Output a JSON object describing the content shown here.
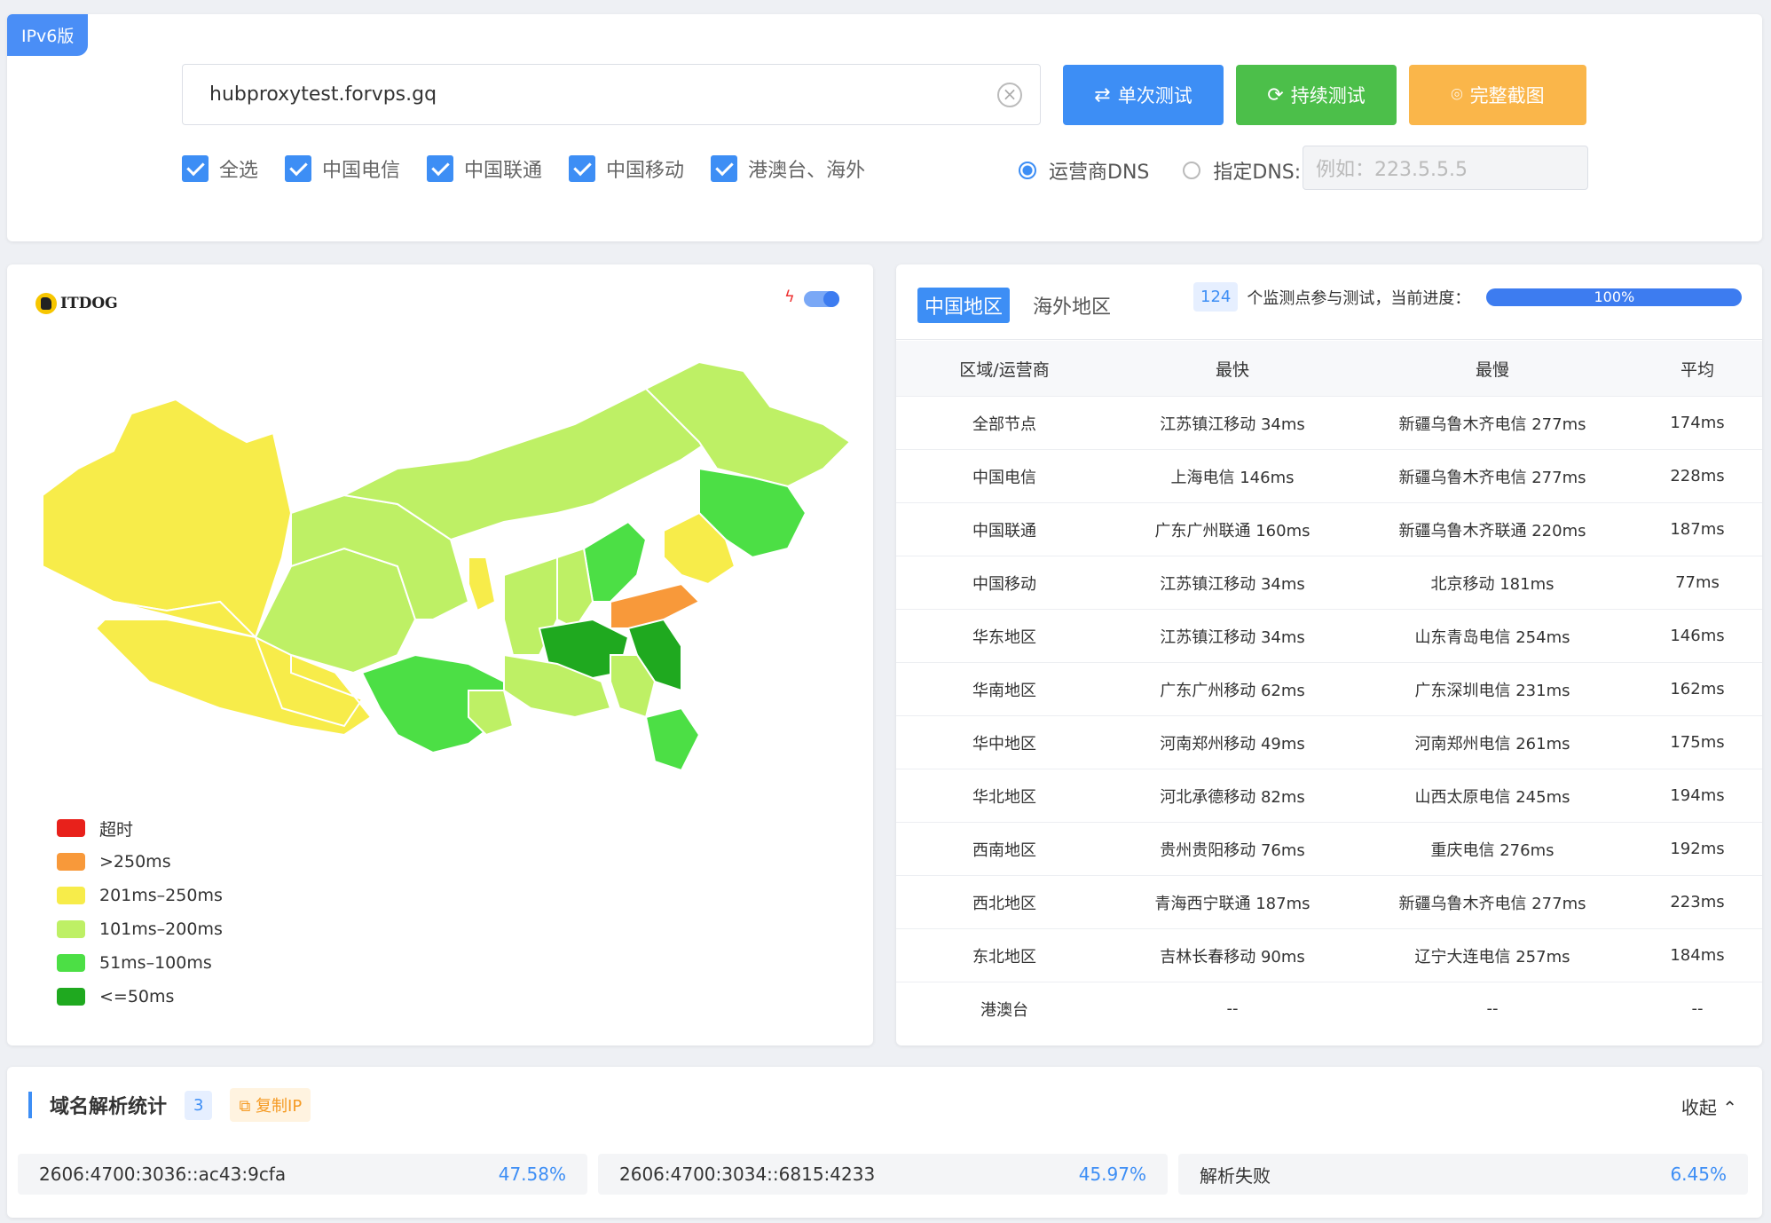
{
  "top": {
    "version_tag": "IPv6版",
    "domain_value": "hubproxytest.forvps.gq",
    "buttons": {
      "single": "单次测试",
      "continuous": "持续测试",
      "screenshot": "完整截图"
    },
    "checkboxes": [
      "全选",
      "中国电信",
      "中国联通",
      "中国移动",
      "港澳台、海外"
    ],
    "dns": {
      "carrier": "运营商DNS",
      "custom": "指定DNS:",
      "placeholder": "例如：223.5.5.5"
    }
  },
  "map": {
    "logo_text": "ITDOG",
    "legend": [
      {
        "label": "超时",
        "color": "#e8211b"
      },
      {
        "label": ">250ms",
        "color": "#f8993a"
      },
      {
        "label": "201ms–250ms",
        "color": "#f7ec4a"
      },
      {
        "label": "101ms–200ms",
        "color": "#bef065"
      },
      {
        "label": "51ms–100ms",
        "color": "#4cdf45"
      },
      {
        "label": "<=50ms",
        "color": "#1fa91f"
      }
    ]
  },
  "stats": {
    "tabs": [
      "中国地区",
      "海外地区"
    ],
    "monitor_count": "124",
    "progress_text": "个监测点参与测试，当前进度：",
    "progress_value": "100%",
    "columns": [
      "区域/运营商",
      "最快",
      "最慢",
      "平均"
    ],
    "rows": [
      [
        "全部节点",
        "江苏镇江移动 34ms",
        "新疆乌鲁木齐电信 277ms",
        "174ms"
      ],
      [
        "中国电信",
        "上海电信 146ms",
        "新疆乌鲁木齐电信 277ms",
        "228ms"
      ],
      [
        "中国联通",
        "广东广州联通 160ms",
        "新疆乌鲁木齐联通 220ms",
        "187ms"
      ],
      [
        "中国移动",
        "江苏镇江移动 34ms",
        "北京移动 181ms",
        "77ms"
      ],
      [
        "华东地区",
        "江苏镇江移动 34ms",
        "山东青岛电信 254ms",
        "146ms"
      ],
      [
        "华南地区",
        "广东广州移动 62ms",
        "广东深圳电信 231ms",
        "162ms"
      ],
      [
        "华中地区",
        "河南郑州移动 49ms",
        "河南郑州电信 261ms",
        "175ms"
      ],
      [
        "华北地区",
        "河北承德移动 82ms",
        "山西太原电信 245ms",
        "194ms"
      ],
      [
        "西南地区",
        "贵州贵阳移动 76ms",
        "重庆电信 276ms",
        "192ms"
      ],
      [
        "西北地区",
        "青海西宁联通 187ms",
        "新疆乌鲁木齐电信 277ms",
        "223ms"
      ],
      [
        "东北地区",
        "吉林长春移动 90ms",
        "辽宁大连电信 257ms",
        "184ms"
      ],
      [
        "港澳台",
        "--",
        "--",
        "--"
      ]
    ]
  },
  "dns_stats": {
    "title": "域名解析统计",
    "count": "3",
    "copy_label": "复制IP",
    "collapse_label": "收起 ⌃",
    "items": [
      {
        "ip": "2606:4700:3036::ac43:9cfa",
        "pct": "47.58%"
      },
      {
        "ip": "2606:4700:3034::6815:4233",
        "pct": "45.97%"
      },
      {
        "ip": "解析失败",
        "pct": "6.45%"
      }
    ]
  }
}
